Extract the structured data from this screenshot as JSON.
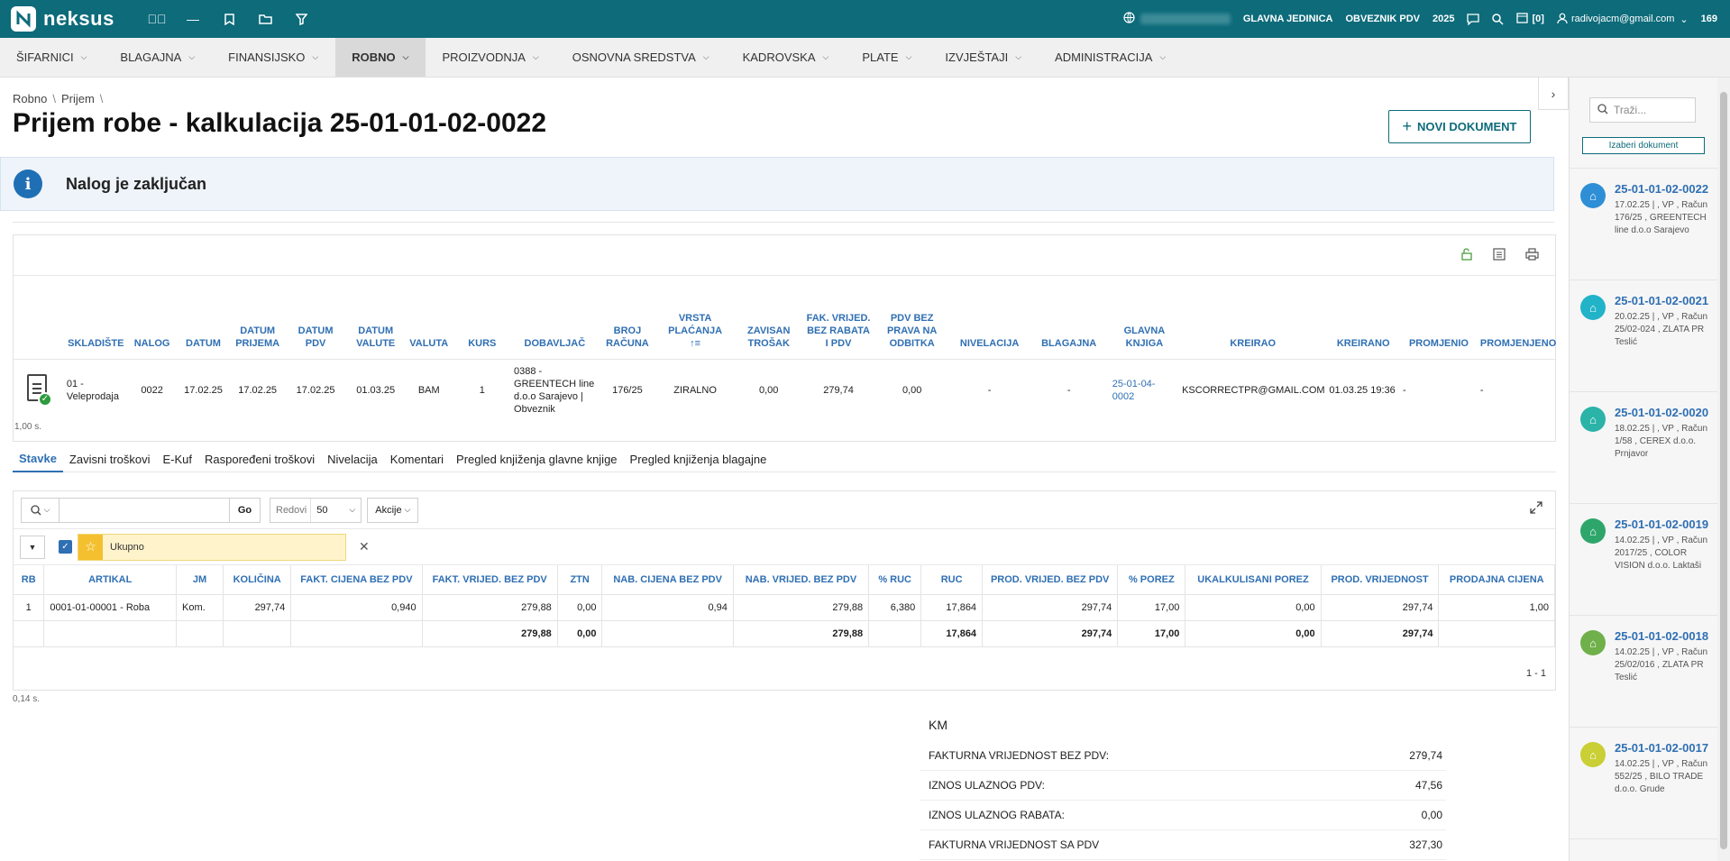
{
  "topbar": {
    "brand": "neksus",
    "org_unit": "GLAVNA JEDINICA",
    "vat_status": "OBVEZNIK PDV",
    "year": "2025",
    "notif_count": "[0]",
    "user": "radivojacm@gmail.com",
    "user_num": "169"
  },
  "nav": [
    {
      "label": "ŠIFARNICI"
    },
    {
      "label": "BLAGAJNA"
    },
    {
      "label": "FINANSIJSKO"
    },
    {
      "label": "ROBNO"
    },
    {
      "label": "PROIZVODNJA"
    },
    {
      "label": "OSNOVNA SREDSTVA"
    },
    {
      "label": "KADROVSKA"
    },
    {
      "label": "PLATE"
    },
    {
      "label": "IZVJEŠTAJI"
    },
    {
      "label": "ADMINISTRACIJA"
    }
  ],
  "breadcrumb": [
    "Robno",
    "Prijem"
  ],
  "page_title": "Prijem robe - kalkulacija 25-01-01-02-0022",
  "new_doc_label": "NOVI DOKUMENT",
  "alert": "Nalog je zaključan",
  "header_table": {
    "columns": [
      "SKLADIŠTE",
      "NALOG",
      "DATUM",
      "DATUM PRIJEMA",
      "DATUM PDV",
      "DATUM VALUTE",
      "VALUTA",
      "KURS",
      "DOBAVLJAČ",
      "BROJ RAČUNA",
      "VRSTA PLAĆANJA",
      "ZAVISAN TROŠAK",
      "FAK. VRIJED. BEZ RABATA I PDV",
      "PDV BEZ PRAVA NA ODBITKA",
      "NIVELACIJA",
      "BLAGAJNA",
      "GLAVNA KNJIGA",
      "KREIRAO",
      "KREIRANO",
      "PROMJENIO",
      "PROMJENJENO"
    ],
    "sort_mark": "↑≡",
    "row": [
      "01 - Veleprodaja",
      "0022",
      "17.02.25",
      "17.02.25",
      "17.02.25",
      "01.03.25",
      "BAM",
      "1",
      "0388 - GREENTECH line d.o.o Sarajevo | Obveznik",
      "176/25",
      "ZIRALNO",
      "0,00",
      "279,74",
      "0,00",
      "-",
      "-",
      "25-01-04-0002",
      "KSCORRECTPR@GMAIL.COM",
      "01.03.25 19:36",
      "-",
      "-"
    ],
    "time": "1,00 s."
  },
  "tabs": [
    "Stavke",
    "Zavisni troškovi",
    "E-Kuf",
    "Raspoređeni troškovi",
    "Nivelacija",
    "Komentari",
    "Pregled knjiženja glavne knjige",
    "Pregled knjiženja blagajne"
  ],
  "grid": {
    "go_label": "Go",
    "rows_label": "Redovi",
    "rows_value": "50",
    "actions_label": "Akcije",
    "filter_label": "Ukupno",
    "columns": [
      "RB",
      "ARTIKAL",
      "JM",
      "KOLIČINA",
      "FAKT. CIJENA BEZ PDV",
      "FAKT. VRIJED. BEZ PDV",
      "ZTN",
      "NAB. CIJENA BEZ PDV",
      "NAB. VRIJED. BEZ PDV",
      "% RUC",
      "RUC",
      "PROD. VRIJED. BEZ PDV",
      "% POREZ",
      "UKALKULISANI POREZ",
      "PROD. VRIJEDNOST",
      "PRODAJNA CIJENA"
    ],
    "rows": [
      [
        "1",
        "0001-01-00001 - Roba",
        "Kom.",
        "297,74",
        "0,940",
        "279,88",
        "0,00",
        "0,94",
        "279,88",
        "6,380",
        "17,864",
        "297,74",
        "17,00",
        "0,00",
        "297,74",
        "1,00"
      ]
    ],
    "total": [
      "",
      "",
      "",
      "",
      "",
      "279,88",
      "0,00",
      "",
      "279,88",
      "",
      "17,864",
      "297,74",
      "17,00",
      "0,00",
      "297,74",
      ""
    ],
    "pager": "1 - 1",
    "time": "0,14 s."
  },
  "summary": {
    "currency": "KM",
    "rows": [
      {
        "label": "FAKTURNA VRIJEDNOST BEZ PDV:",
        "value": "279,74"
      },
      {
        "label": "IZNOS ULAZNOG PDV:",
        "value": "47,56"
      },
      {
        "label": "IZNOS ULAZNOG RABATA:",
        "value": "0,00"
      },
      {
        "label": "FAKTURNA VRIJEDNOST SA PDV",
        "value": "327,30"
      }
    ]
  },
  "right_panel": {
    "search_placeholder": "Traži...",
    "choose_label": "Izaberi dokument",
    "items": [
      {
        "title": "25-01-01-02-0022",
        "desc": "17.02.25 | , VP , Račun 176/25 , GREENTECH line d.o.o Sarajevo",
        "color": "#2e8fd6"
      },
      {
        "title": "25-01-01-02-0021",
        "desc": "20.02.25 | , VP , Račun 25/02-024 , ZLATA PR Teslić",
        "color": "#22b3c9"
      },
      {
        "title": "25-01-01-02-0020",
        "desc": "18.02.25 | , VP , Račun 1/58 , CEREX d.o.o. Prnjavor",
        "color": "#2bb3a8"
      },
      {
        "title": "25-01-01-02-0019",
        "desc": "14.02.25 | , VP , Račun 2017/25 , COLOR VISION d.o.o. Laktaši",
        "color": "#2ea66b"
      },
      {
        "title": "25-01-01-02-0018",
        "desc": "14.02.25 | , VP , Račun 25/02/016 , ZLATA PR Teslić",
        "color": "#6fb04a"
      },
      {
        "title": "25-01-01-02-0017",
        "desc": "14.02.25 | , VP , Račun 552/25 , BILO TRADE d.o.o. Grude",
        "color": "#c9cf34"
      }
    ]
  }
}
